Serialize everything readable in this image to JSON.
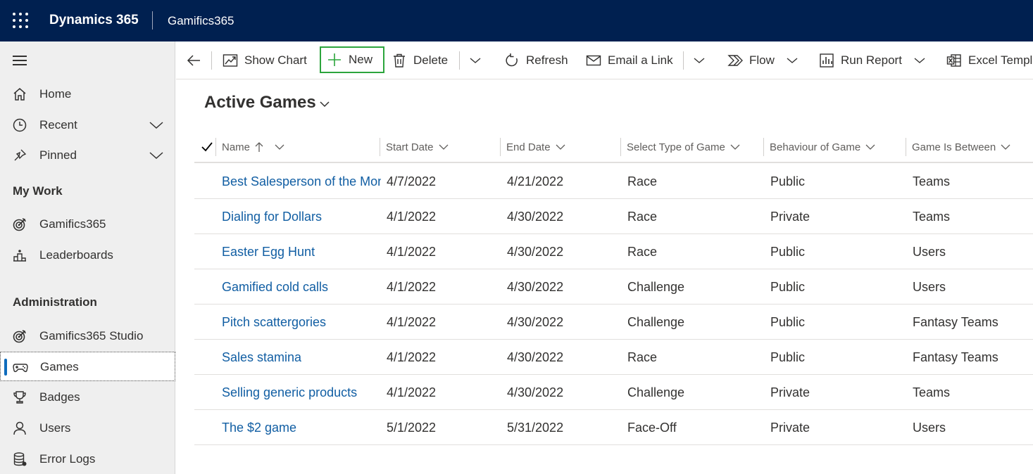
{
  "topbar": {
    "brand": "Dynamics 365",
    "app": "Gamifics365"
  },
  "sidebar": {
    "home": "Home",
    "recent": "Recent",
    "pinned": "Pinned",
    "my_work_title": "My Work",
    "my_work": [
      "Gamifics365",
      "Leaderboards"
    ],
    "admin_title": "Administration",
    "admin": [
      "Gamifics365 Studio",
      "Games",
      "Badges",
      "Users",
      "Error Logs"
    ]
  },
  "commands": {
    "show_chart": "Show Chart",
    "new": "New",
    "delete": "Delete",
    "refresh": "Refresh",
    "email_link": "Email a Link",
    "flow": "Flow",
    "run_report": "Run Report",
    "excel": "Excel Templates"
  },
  "view": {
    "title": "Active Games"
  },
  "grid": {
    "columns": [
      "Name",
      "Start Date",
      "End Date",
      "Select Type of Game",
      "Behaviour of Game",
      "Game Is Between"
    ],
    "rows": [
      [
        "Best Salesperson of the Month",
        "4/7/2022",
        "4/21/2022",
        "Race",
        "Public",
        "Teams"
      ],
      [
        "Dialing for Dollars",
        "4/1/2022",
        "4/30/2022",
        "Race",
        "Private",
        "Teams"
      ],
      [
        "Easter Egg Hunt",
        "4/1/2022",
        "4/30/2022",
        "Race",
        "Public",
        "Users"
      ],
      [
        "Gamified cold calls",
        "4/1/2022",
        "4/30/2022",
        "Challenge",
        "Public",
        "Users"
      ],
      [
        "Pitch scattergories",
        "4/1/2022",
        "4/30/2022",
        "Challenge",
        "Public",
        "Fantasy Teams"
      ],
      [
        "Sales stamina",
        "4/1/2022",
        "4/30/2022",
        "Race",
        "Public",
        "Fantasy Teams"
      ],
      [
        "Selling generic products",
        "4/1/2022",
        "4/30/2022",
        "Challenge",
        "Private",
        "Teams"
      ],
      [
        "The $2 game",
        "5/1/2022",
        "5/31/2022",
        "Face-Off",
        "Private",
        "Users"
      ]
    ]
  },
  "colors": {
    "topbar": "#002050",
    "link": "#115ea3",
    "new_highlight": "#2ca53c",
    "selected_bar": "#0f6cbd"
  }
}
